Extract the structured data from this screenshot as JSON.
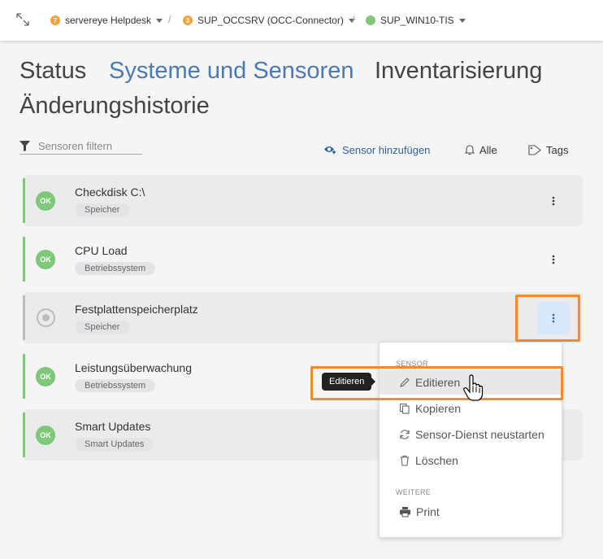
{
  "breadcrumb": [
    {
      "badge": "7",
      "badge_color": "#f0a23c",
      "label": "servereye Helpdesk"
    },
    {
      "badge": "3",
      "badge_color": "#f0a23c",
      "label": "SUP_OCCSRV (OCC-Connector)"
    },
    {
      "badge": "",
      "badge_color": "#7ec87a",
      "label": "SUP_WIN10-TIS"
    }
  ],
  "nav": {
    "tabs": [
      "Status",
      "Systeme und Sensoren",
      "Inventarisierung",
      "Änderungshistorie"
    ],
    "active": "Systeme und Sensoren"
  },
  "toolbar": {
    "filter_placeholder": "Sensoren filtern",
    "add_sensor": "Sensor hinzufügen",
    "all": "Alle",
    "tags": "Tags"
  },
  "sensors": [
    {
      "status": "OK",
      "name": "Checkdisk C:\\",
      "tag": "Speicher"
    },
    {
      "status": "OK",
      "name": "CPU Load",
      "tag": "Betriebssystem"
    },
    {
      "status": "",
      "name": "Festplattenspeicherplatz",
      "tag": "Speicher"
    },
    {
      "status": "OK",
      "name": "Leistungsüberwachung",
      "tag": "Betriebssystem"
    },
    {
      "status": "OK",
      "name": "Smart Updates",
      "tag": "Smart Updates"
    }
  ],
  "menu": {
    "section_sensor": "SENSOR",
    "edit": "Editieren",
    "copy": "Kopieren",
    "restart": "Sensor-Dienst neustarten",
    "delete": "Löschen",
    "section_more": "WEITERE",
    "print": "Print"
  },
  "tooltip": "Editieren",
  "colors": {
    "accent": "#4a7ab5",
    "ok": "#7ec87a",
    "highlight": "#f08c2e",
    "pending": "#bcbcbc"
  }
}
